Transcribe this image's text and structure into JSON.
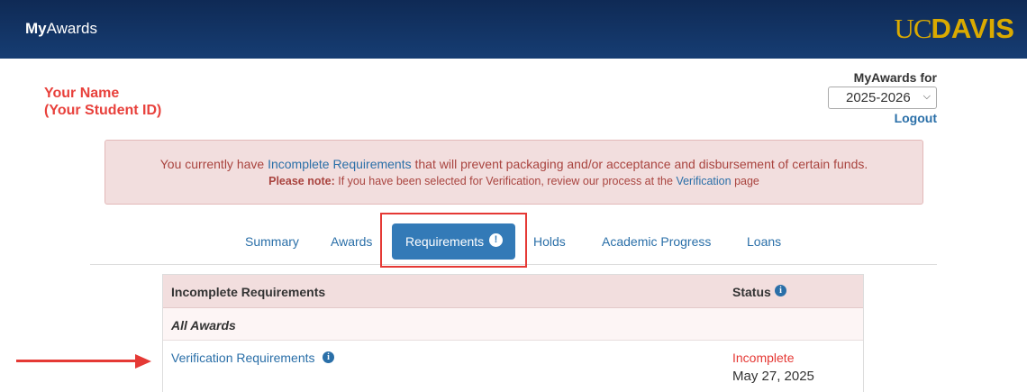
{
  "header": {
    "title_bold": "My",
    "title_rest": "Awards",
    "logo_uc": "UC",
    "logo_davis": "DAVIS"
  },
  "student": {
    "name": "Your Name",
    "id": "(Your Student ID)"
  },
  "award_year": {
    "label": "MyAwards for",
    "selected": "2025-2026",
    "logout": "Logout"
  },
  "alert": {
    "text_before": "You currently have ",
    "link_text": "Incomplete Requirements",
    "text_after": " that will prevent packaging and/or acceptance and disbursement of certain funds.",
    "note_label": "Please note:",
    "note_before": " If you have been selected for Verification, review our process at the ",
    "note_link": "Verification",
    "note_after": " page"
  },
  "tabs": [
    {
      "label": "Summary"
    },
    {
      "label": "Awards"
    },
    {
      "label": "Requirements",
      "active": true
    },
    {
      "label": "Holds"
    },
    {
      "label": "Academic Progress"
    },
    {
      "label": "Loans"
    }
  ],
  "table": {
    "header_requirements": "Incomplete Requirements",
    "header_status": "Status",
    "group_label": "All Awards",
    "rows": [
      {
        "requirement": "Verification Requirements",
        "status": "Incomplete",
        "date": "May 27, 2025"
      }
    ]
  },
  "colors": {
    "header_bg": "#163d73",
    "accent": "#337ab7",
    "link": "#2a6fa8",
    "alert_bg": "#f2dede",
    "alert_text": "#a9443f",
    "annotation_red": "#e53935",
    "logo_gold": "#daaa00"
  }
}
